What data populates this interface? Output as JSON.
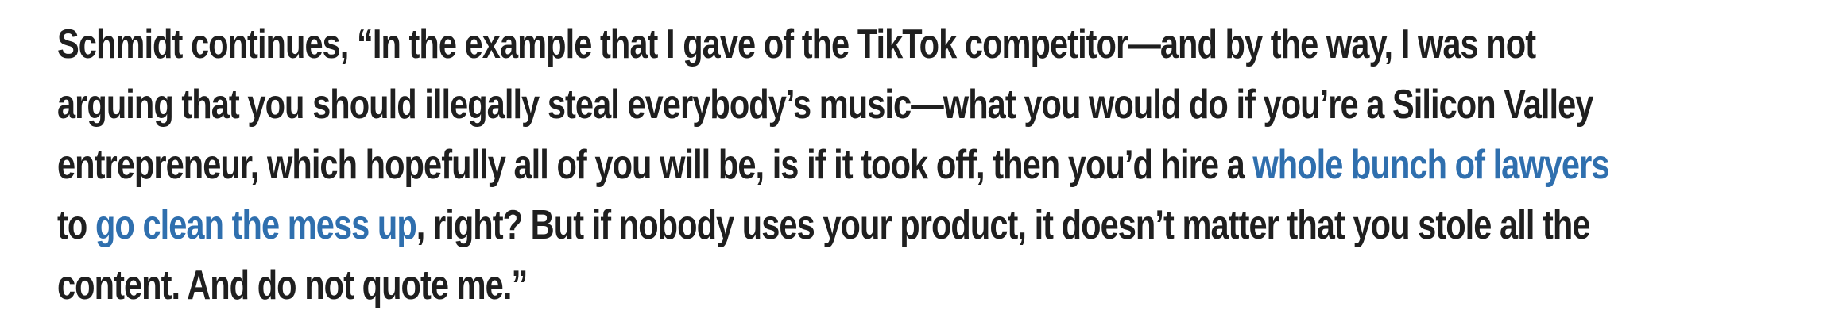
{
  "article": {
    "paragraph": {
      "line1": "Schmidt continues, “In the example that I gave of the TikTok competitor—and by the way, I was not",
      "line2": "arguing that you should illegally steal everybody’s music—what you would do if you’re a Silicon Valley",
      "line3_text": "entrepreneur, which hopefully all of you will be, is if it took off, then you’d hire a ",
      "link1": "whole bunch of lawyers",
      "line4_pre": "to ",
      "link2": "go clean the mess up",
      "line4_post": ", right? But if nobody uses your product, it doesn’t matter that you stole all the",
      "line5": "content. And do not quote me.”"
    },
    "link_color": "#2f6fae",
    "text_color": "#1f1f1f"
  }
}
